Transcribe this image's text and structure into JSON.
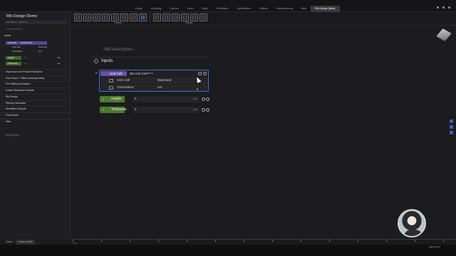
{
  "tabs": [
    "Create",
    "Modeling",
    "Lattices",
    "Mesh",
    "Math",
    "Simulation",
    "Optimization",
    "Utilities",
    "Manufacturing",
    "Beta",
    "Rib Design (Beta)"
  ],
  "active_tab_index": 10,
  "ribbon": {
    "create_label": "Create",
    "modify_label": "Modify"
  },
  "sidebar": {
    "title": "Rib Design Demo",
    "search_placeholder": "Add Block... (Ctrl+A)",
    "desc_placeholder": "Add description...",
    "inputs_label": "Inputs",
    "unit_cell_badge": "Unit Cell",
    "unit_cell_name": "2D Unit Cell",
    "unit_cell_row": "Unit Cell",
    "unit_cell_value": "Diamond",
    "orientation_row": "Orientation",
    "orientation_value": "UV",
    "height_badge": "Height",
    "height_value": "1",
    "height_unit": "mm",
    "thickness_badge": "Thickness",
    "thickness_value": "1",
    "thickness_unit": "mm",
    "sections": [
      "Import part and Feature Extraction",
      "Panel Input + Offset panel geometry",
      "Pre-Ribbing Simulation",
      "Extract Simulation Results",
      "Rib Design",
      "Ribbing Simulation",
      "Simulation Outputs",
      "Final Visual",
      "Misc"
    ],
    "new_section": "+ New Section"
  },
  "canvas": {
    "add_description": "Add description...",
    "inputs_title": "Inputs",
    "unit_cell_badge": "Unit Cell",
    "unit_cell_name": "2D Unit Cell",
    "beta": "BETA",
    "unit_cell_label": "Unit Cell",
    "unit_cell_value": "Diamond",
    "orientation_label": "Orientation:",
    "orientation_value": "UV",
    "height_label": "Height",
    "height_value": "1",
    "height_unit": "mm",
    "thickness_label": "Thickness",
    "thickness_value": "1",
    "thickness_unit": "mm"
  },
  "bottom": {
    "output_label": "Output",
    "output_tab": "output_results"
  },
  "timeline": {
    "start_label": "0 ms"
  },
  "zoom_label": "Highest Res",
  "colors": {
    "unit_cell": "#6b4fa8",
    "param": "#4c7a2e",
    "selection": "#3a6fd8"
  }
}
